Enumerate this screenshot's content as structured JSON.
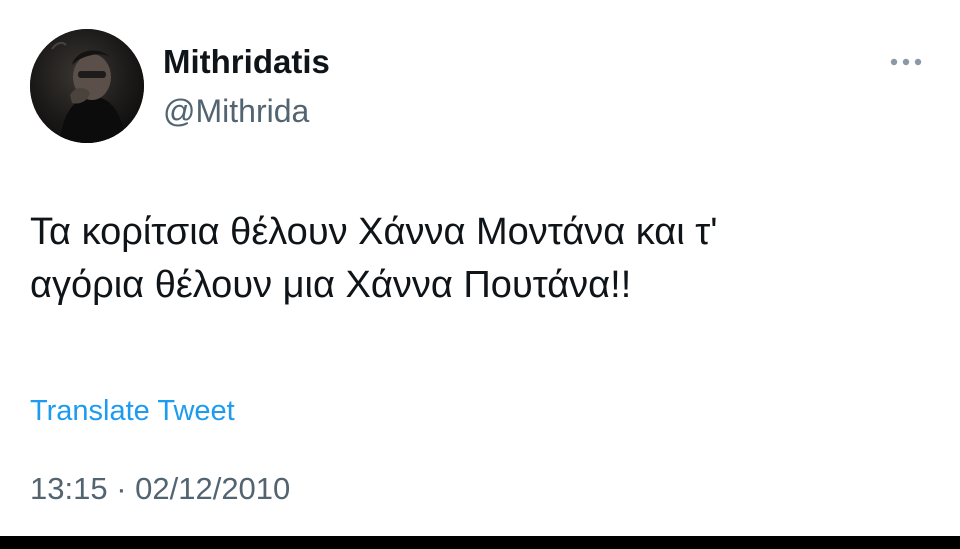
{
  "tweet": {
    "author": {
      "display_name": "Mithridatis",
      "handle": "@Mithrida",
      "avatar_icon": "profile-photo"
    },
    "more_icon": "more-dots-icon",
    "text": "Τα κορίτσια θέλουν Χάννα Μοντάνα και τ'\nαγόρια θέλουν μια Χάννα Πουτάνα!!",
    "translate_label": "Translate Tweet",
    "timestamp": "13:15 · 02/12/2010"
  },
  "colors": {
    "text": "#0f1419",
    "secondary": "#536471",
    "link": "#1d9bf0",
    "background": "#ffffff"
  }
}
